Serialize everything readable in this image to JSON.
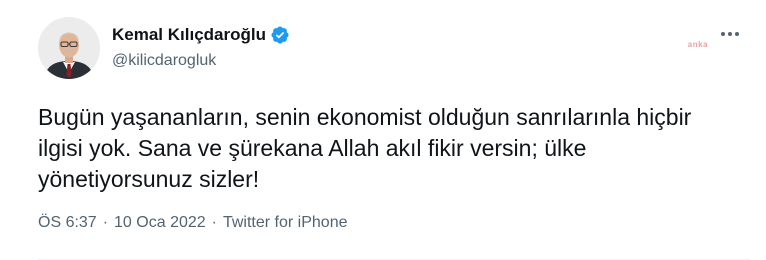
{
  "author": {
    "display_name": "Kemal Kılıçdaroğlu",
    "handle": "@kilicdarogluk",
    "verified": true,
    "avatar_icon": "profile-photo"
  },
  "watermark": "anka",
  "tweet": {
    "text": "Bugün yaşananların, senin ekonomist olduğun sanrılarınla hiçbir ilgisi yok. Sana ve şürekana Allah akıl fikir versin; ülke yönetiyorsunuz sizler!"
  },
  "meta": {
    "time": "ÖS 6:37",
    "separator": "·",
    "date": "10 Oca 2022",
    "source": "Twitter for iPhone"
  },
  "colors": {
    "verified_badge": "#1d9bf0",
    "secondary_text": "#536471",
    "primary_text": "#0f1419"
  }
}
